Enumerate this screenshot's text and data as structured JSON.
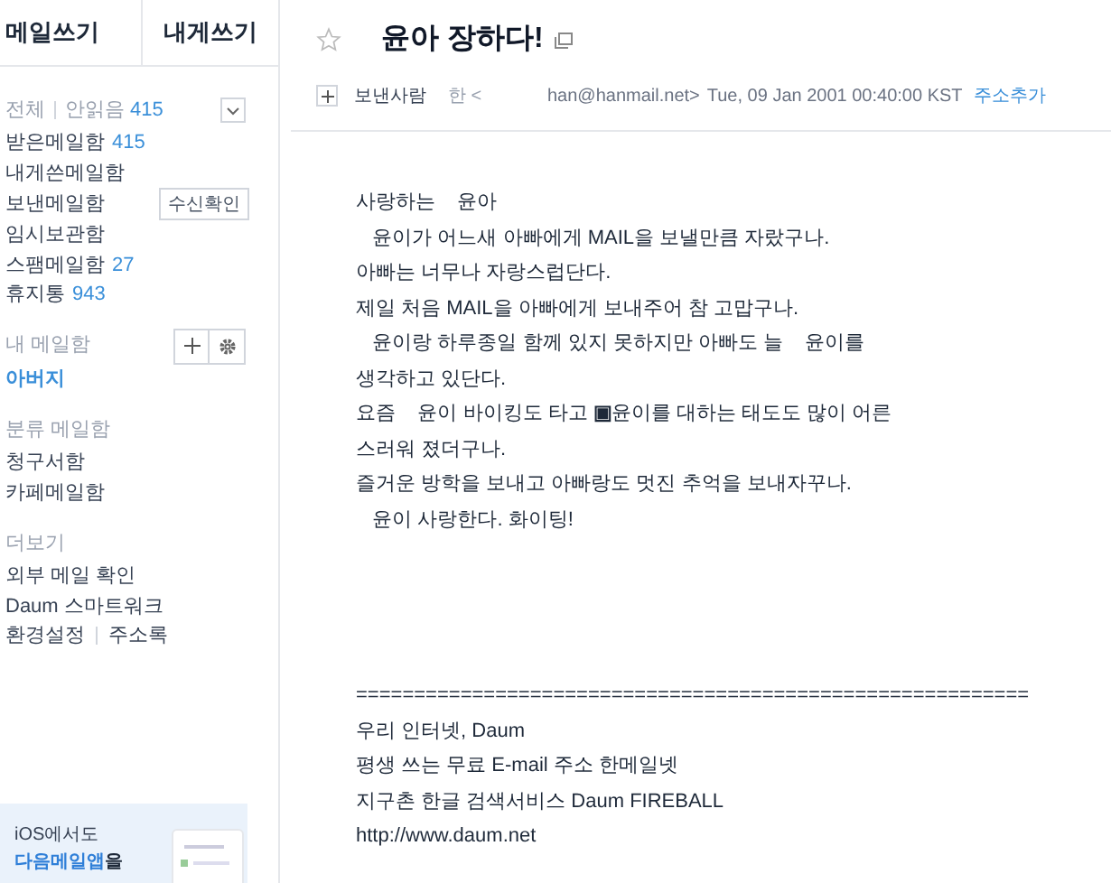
{
  "sidebar": {
    "compose_buttons": [
      "메일쓰기",
      "내게쓰기"
    ],
    "mailbox_header": {
      "all_label": "전체",
      "unread_label": "안읽음",
      "unread_count": "415"
    },
    "folders": [
      {
        "name": "받은메일함",
        "count": "415"
      },
      {
        "name": "내게쓴메일함"
      },
      {
        "name": "보낸메일함",
        "action": "수신확인"
      },
      {
        "name": "임시보관함"
      },
      {
        "name": "스팸메일함",
        "count": "27"
      },
      {
        "name": "휴지통",
        "count": "943"
      }
    ],
    "my_mailbox": {
      "title": "내 메일함",
      "folders": [
        {
          "name": "아버지"
        }
      ]
    },
    "category": {
      "title": "분류 메일함",
      "folders": [
        {
          "name": "청구서함"
        },
        {
          "name": "카페메일함"
        }
      ]
    },
    "more": {
      "title": "더보기",
      "links": [
        "외부 메일 확인",
        "Daum 스마트워크"
      ],
      "settings_links": [
        "환경설정",
        "주소록"
      ]
    },
    "banner": {
      "line_1": "iOS에서도",
      "highlight": "다음메일앱",
      "rest": "을"
    }
  },
  "message": {
    "title": "윤아 장하다!",
    "starred": false,
    "sender_label": "보낸사람",
    "sender_name": "한 <",
    "sender_email": "han@hanmail.net>",
    "date": "Tue, 09 Jan 2001 00:40:00 KST",
    "add_address": "주소추가",
    "body_lines": [
      "사랑하는    윤아",
      "   윤이가 어느새 아빠에게 MAIL을 보낼만큼 자랐구나.",
      "아빠는 너무나 자랑스럽단다.",
      "제일 처음 MAIL을 아빠에게 보내주어 참 고맙구나.",
      "   윤이랑 하루종일 함께 있지 못하지만 아빠도 늘    윤이를",
      "생각하고 있단다.",
      "요즘    윤이 바이킹도 타고 **▣**윤이를 대하는 태도도 많이 어른",
      "스러워 졌더구나.",
      "즐거운 방학을 보내고 아빠랑도 멋진 추억을 보내자꾸나.",
      "   윤이 사랑한다. 화이팅!"
    ],
    "signature_lines": [
      "==========================================================",
      "우리 인터넷, Daum",
      "평생 쓰는 무료 E-mail 주소 한메일넷",
      "지구촌 한글 검색서비스 Daum FIREBALL",
      "http://www.daum.net"
    ]
  }
}
